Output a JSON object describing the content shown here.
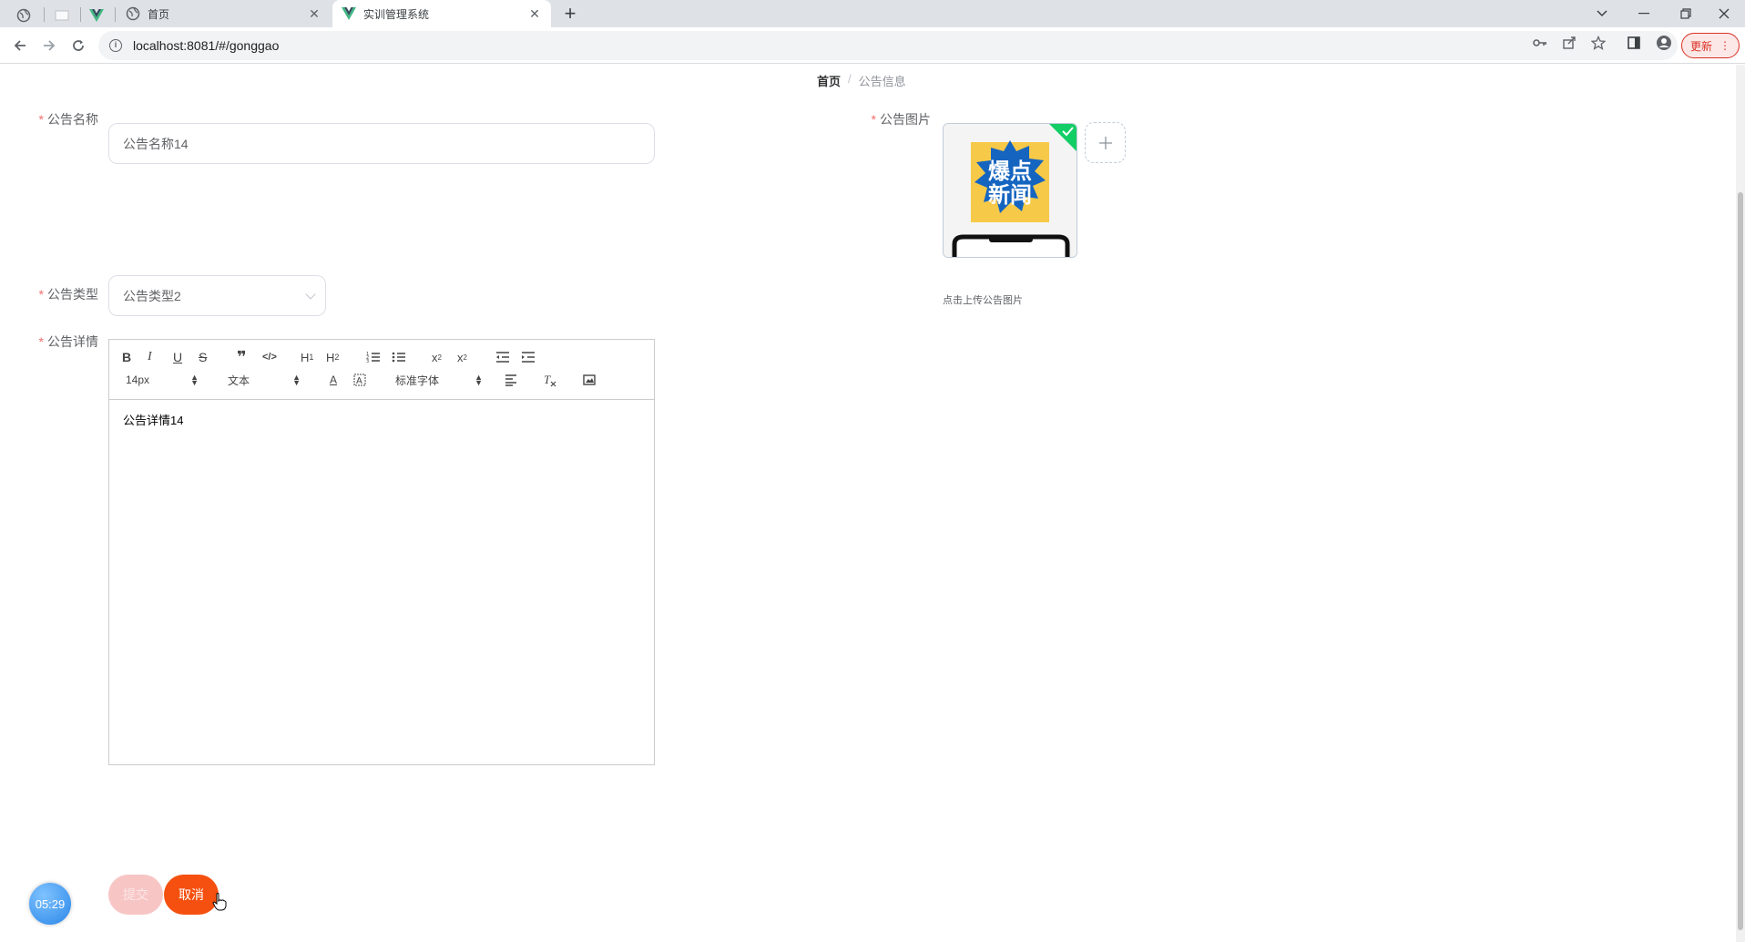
{
  "browser": {
    "tabs": [
      {
        "title": "首页"
      },
      {
        "title": "实训管理系统"
      }
    ],
    "close_glyph": "✕",
    "new_tab_glyph": "+",
    "url": "localhost:8081/#/gonggao",
    "update_label": "更新"
  },
  "breadcrumb": {
    "home": "首页",
    "separator": "/",
    "current": "公告信息"
  },
  "form": {
    "required_mark": "*",
    "name": {
      "label": "公告名称",
      "value": "公告名称14"
    },
    "image": {
      "label": "公告图片",
      "tip": "点击上传公告图片",
      "thumb_text_line1": "爆点",
      "thumb_text_line2": "新闻"
    },
    "type": {
      "label": "公告类型",
      "value": "公告类型2"
    },
    "detail": {
      "label": "公告详情",
      "font_size": "14px",
      "paragraph": "文本",
      "font_family": "标准字体",
      "content": "公告详情14"
    }
  },
  "buttons": {
    "submit": "提交",
    "cancel": "取消"
  },
  "timer": "05:29",
  "colors": {
    "accent": "#f5500f",
    "required": "#f56c6c",
    "success": "#13ce66",
    "link": "#409eff"
  }
}
